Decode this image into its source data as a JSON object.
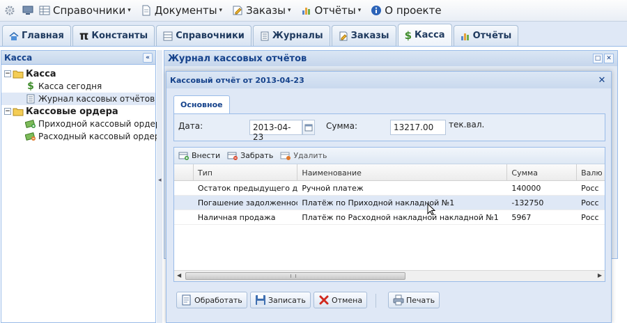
{
  "menubar": {
    "items": [
      {
        "label": "Справочники",
        "has_dropdown": true,
        "icon": "grid-icon"
      },
      {
        "label": "Документы",
        "has_dropdown": true,
        "icon": "document-icon"
      },
      {
        "label": "Заказы",
        "has_dropdown": true,
        "icon": "order-icon"
      },
      {
        "label": "Отчёты",
        "has_dropdown": true,
        "icon": "chart-icon"
      },
      {
        "label": "О проекте",
        "has_dropdown": false,
        "icon": "info-icon"
      }
    ]
  },
  "tabs": [
    {
      "label": "Главная",
      "icon": "home-icon",
      "active": false
    },
    {
      "label": "Константы",
      "icon": "pi-icon",
      "active": false
    },
    {
      "label": "Справочники",
      "icon": "grid-icon",
      "active": false
    },
    {
      "label": "Журналы",
      "icon": "journal-icon",
      "active": false
    },
    {
      "label": "Заказы",
      "icon": "order-icon",
      "active": false
    },
    {
      "label": "Касса",
      "icon": "dollar-icon",
      "active": true
    },
    {
      "label": "Отчёты",
      "icon": "chart-icon",
      "active": false
    }
  ],
  "left_panel": {
    "title": "Касса",
    "collapse_glyph": "«",
    "tree": [
      {
        "label": "Касса",
        "root": true,
        "icon": "folder-icon",
        "expander": "−"
      },
      {
        "label": "Касса сегодня",
        "root": false,
        "icon": "dollar-icon"
      },
      {
        "label": "Журнал кассовых отчётов",
        "root": false,
        "icon": "journal-icon",
        "selected": true
      },
      {
        "label": "Кассовые ордера",
        "root": true,
        "icon": "folder-icon",
        "expander": "−"
      },
      {
        "label": "Приходной кассовый ордер",
        "root": false,
        "icon": "money-in-icon"
      },
      {
        "label": "Расходный кассовый ордер",
        "root": false,
        "icon": "money-out-icon"
      }
    ]
  },
  "journal_window": {
    "title": "Журнал кассовых отчётов"
  },
  "dialog": {
    "title": "Кассовый отчёт от 2013-04-23",
    "tab_label": "Основное",
    "form": {
      "date_label": "Дата:",
      "date_value": "2013-04-23",
      "sum_label": "Сумма:",
      "sum_value": "13217.00",
      "currency_label": "тек.вал."
    },
    "toolbar": {
      "add_label": "Внести",
      "take_label": "Забрать",
      "delete_label": "Удалить"
    },
    "grid": {
      "columns": [
        "Тип",
        "Наименование",
        "Сумма",
        "Валю"
      ],
      "rows": [
        {
          "type": "Остаток предыдущего д...",
          "name": "Ручной платеж",
          "sum": "140000",
          "currency": "Росс",
          "highlighted": false
        },
        {
          "type": "Погашение задолженности",
          "name": "Платёж по Приходной накладной №1",
          "sum": "-132750",
          "currency": "Росс",
          "highlighted": true
        },
        {
          "type": "Наличная продажа",
          "name": "Платёж по Расходной накладной накладной №1",
          "sum": "5967",
          "currency": "Росс",
          "highlighted": false
        }
      ]
    },
    "buttons": {
      "process_label": "Обработать",
      "save_label": "Записать",
      "cancel_label": "Отмена",
      "print_label": "Печать"
    }
  },
  "colors": {
    "header_text": "#15428b",
    "panel_border": "#99bbe8",
    "selected_row": "#dfe8f6"
  }
}
